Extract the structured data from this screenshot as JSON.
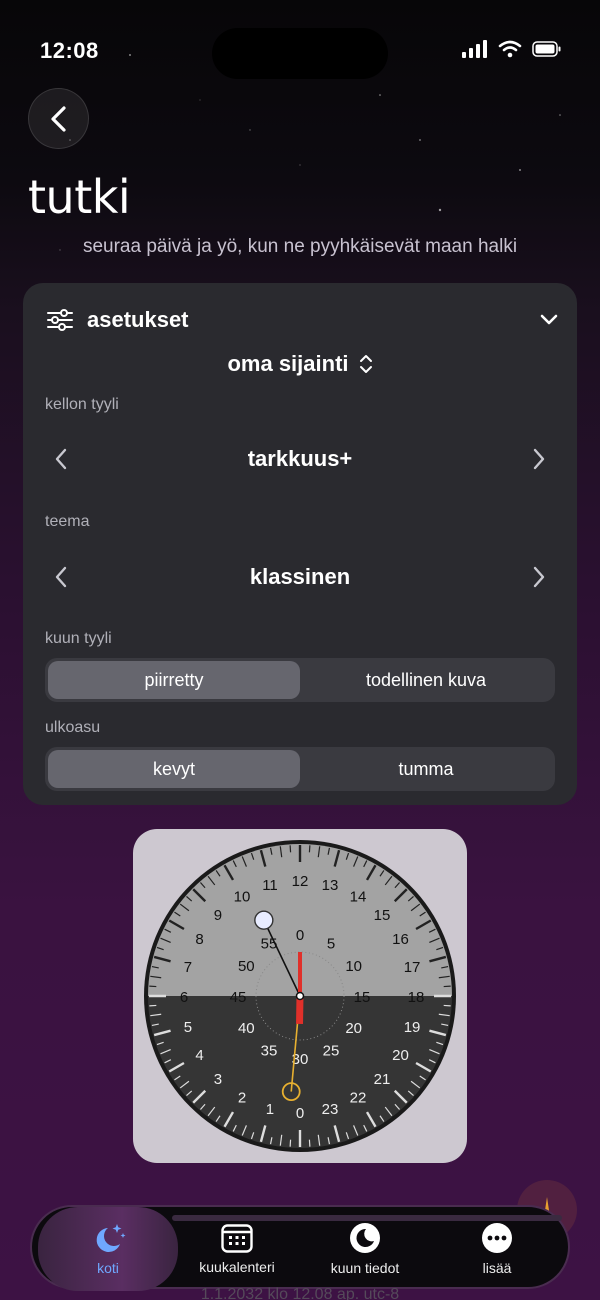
{
  "status": {
    "time": "12:08"
  },
  "header": {
    "title": "tutki",
    "subtitle": "seuraa päivä ja yö, kun ne pyyhkäisevät maan halki"
  },
  "settings": {
    "label": "asetukset",
    "location": "oma sijainti",
    "clock_style_label": "kellon tyyli",
    "clock_style_value": "tarkkuus+",
    "theme_label": "teema",
    "theme_value": "klassinen",
    "moon_style_label": "kuun tyyli",
    "moon_style_options": [
      "piirretty",
      "todellinen kuva"
    ],
    "moon_style_selected": 0,
    "appearance_label": "ulkoasu",
    "appearance_options": [
      "kevyt",
      "tumma"
    ],
    "appearance_selected": 0
  },
  "clock": {
    "hour_labels": [
      "0",
      "1",
      "2",
      "3",
      "4",
      "5",
      "6",
      "7",
      "8",
      "9",
      "10",
      "11",
      "12",
      "13",
      "14",
      "15",
      "16",
      "17",
      "18",
      "19",
      "20",
      "21",
      "22",
      "23"
    ],
    "minute_labels": [
      "0",
      "5",
      "10",
      "15",
      "20",
      "25",
      "30",
      "35",
      "40",
      "45",
      "50",
      "55"
    ],
    "day_color": "#a3a3a3",
    "night_color": "#353535",
    "hand_color": "#e0302a",
    "sun_hand_color": "#e8b030"
  },
  "tabs": [
    {
      "label": "koti",
      "icon": "moon-stars-icon",
      "active": true
    },
    {
      "label": "kuukalenteri",
      "icon": "calendar-icon",
      "active": false
    },
    {
      "label": "kuun tiedot",
      "icon": "moon-icon",
      "active": false
    },
    {
      "label": "lisää",
      "icon": "more-icon",
      "active": false
    }
  ],
  "footer": {
    "text": "1.1.2032 klo 12.08 ap. utc-8"
  },
  "colors": {
    "accent": "#6fa8ff",
    "panel": "#2a2a2f",
    "background": "#3a1240"
  }
}
